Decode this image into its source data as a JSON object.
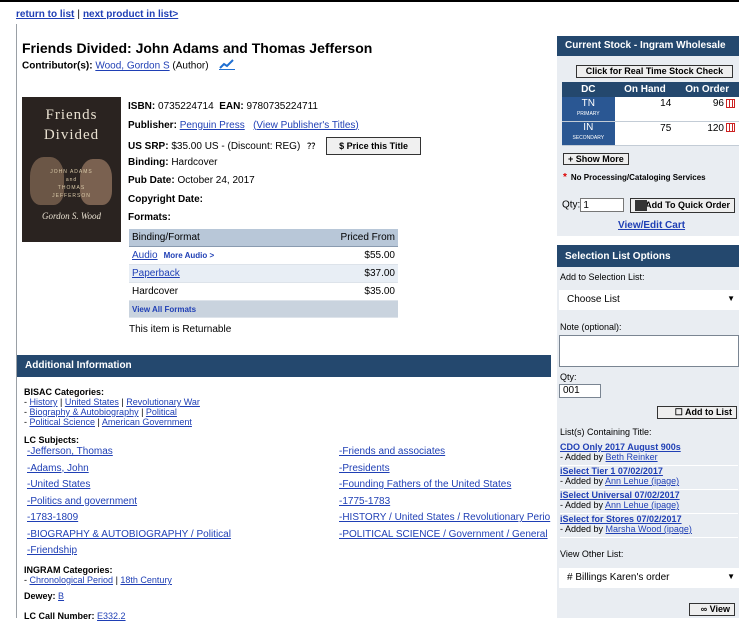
{
  "nav": {
    "return": "return to list",
    "sep": "|",
    "next": "next product in list>"
  },
  "product": {
    "title": "Friends Divided: John Adams and Thomas Jefferson",
    "contributor_label": "Contributor(s):",
    "contributor_name": "Wood, Gordon S",
    "contributor_role": "(Author)",
    "cover": {
      "line1": "Friends",
      "line2": "Divided",
      "s1": "JOHN ADAMS",
      "s2": "and",
      "s3": "THOMAS",
      "s4": "JEFFERSON",
      "author": "Gordon S. Wood"
    },
    "isbn_label": "ISBN:",
    "isbn": "0735224714",
    "ean_label": "EAN:",
    "ean": "9780735224711",
    "publisher_label": "Publisher:",
    "publisher": "Penguin Press",
    "publisher_titles": "(View Publisher's Titles)",
    "srp_label": "US SRP:",
    "srp": "$35.00 US",
    "discount": "- (Discount: REG)",
    "price_btn": "$ Price this Title",
    "binding_label": "Binding:",
    "binding": "Hardcover",
    "pubdate_label": "Pub Date:",
    "pubdate": "October 24, 2017",
    "copyright_label": "Copyright Date:",
    "formats_label": "Formats:",
    "returnable": "This item is Returnable"
  },
  "formats": {
    "headers": [
      "Binding/Format",
      "Priced From"
    ],
    "rows": [
      {
        "format": "Audio",
        "more": "More Audio >",
        "price": "$55.00"
      },
      {
        "format": "Paperback",
        "price": "$37.00"
      },
      {
        "format": "Hardcover",
        "price": "$35.00"
      }
    ],
    "footer": "View All Formats"
  },
  "additional": {
    "header": "Additional Information",
    "bisac_label": "BISAC Categories:",
    "bisac": [
      [
        "History",
        "United States",
        "Revolutionary War"
      ],
      [
        "Biography & Autobiography",
        "Political"
      ],
      [
        "Political Science",
        "American Government"
      ]
    ],
    "lc_label": "LC Subjects:",
    "lc_left": [
      "-Jefferson, Thomas",
      "-Adams, John",
      "-United States",
      "-Politics and government",
      "-1783-1809",
      "-BIOGRAPHY & AUTOBIOGRAPHY / Political",
      "-Friendship"
    ],
    "lc_right": [
      "-Friends and associates",
      "-Presidents",
      "-Founding Fathers of the United States",
      "-1775-1783",
      "-HISTORY / United States / Revolutionary Perio",
      "-POLITICAL SCIENCE / Government / General"
    ],
    "ingram_label": "INGRAM Categories:",
    "ingram": [
      "Chronological Period",
      "18th Century"
    ],
    "dewey_label": "Dewey:",
    "dewey": "B",
    "lccall_label": "LC Call Number:",
    "lccall": "E332.2"
  },
  "stock": {
    "header": "Current Stock - Ingram Wholesale",
    "realtime_btn": "Click for Real Time Stock Check",
    "headers": [
      "DC",
      "On Hand",
      "On Order"
    ],
    "rows": [
      {
        "dc": "TN",
        "type": "PRIMARY",
        "on_hand": "14",
        "on_order": "96"
      },
      {
        "dc": "IN",
        "type": "SECONDARY",
        "on_hand": "75",
        "on_order": "120"
      }
    ],
    "show_more": "+ Show More",
    "no_processing": "No Processing/Cataloging Services",
    "qty_label": "Qty:",
    "qty_value": "1",
    "add_quick": "Add To Quick Order",
    "view_cart": "View/Edit Cart"
  },
  "selection": {
    "header": "Selection List Options",
    "add_label": "Add to Selection List:",
    "choose": "Choose List",
    "note_label": "Note (optional):",
    "qty_label": "Qty:",
    "qty_value": "001",
    "add_btn": "Add to List",
    "containing_label": "List(s) Containing Title:",
    "lists": [
      {
        "name": "CDO Only 2017 August 900s",
        "added_prefix": "- Added by",
        "by": "Beth Reinker"
      },
      {
        "name": "iSelect Tier 1 07/02/2017",
        "added_prefix": "- Added by",
        "by": "Ann Lehue (ipage)"
      },
      {
        "name": "iSelect Universal 07/02/2017",
        "added_prefix": "- Added by",
        "by": "Ann Lehue (ipage)"
      },
      {
        "name": "iSelect for Stores 07/02/2017",
        "added_prefix": "- Added by",
        "by": "Marsha Wood (ipage)"
      }
    ],
    "view_other_label": "View Other List:",
    "other_list": "# Billings Karen's order",
    "view_btn": "View"
  }
}
